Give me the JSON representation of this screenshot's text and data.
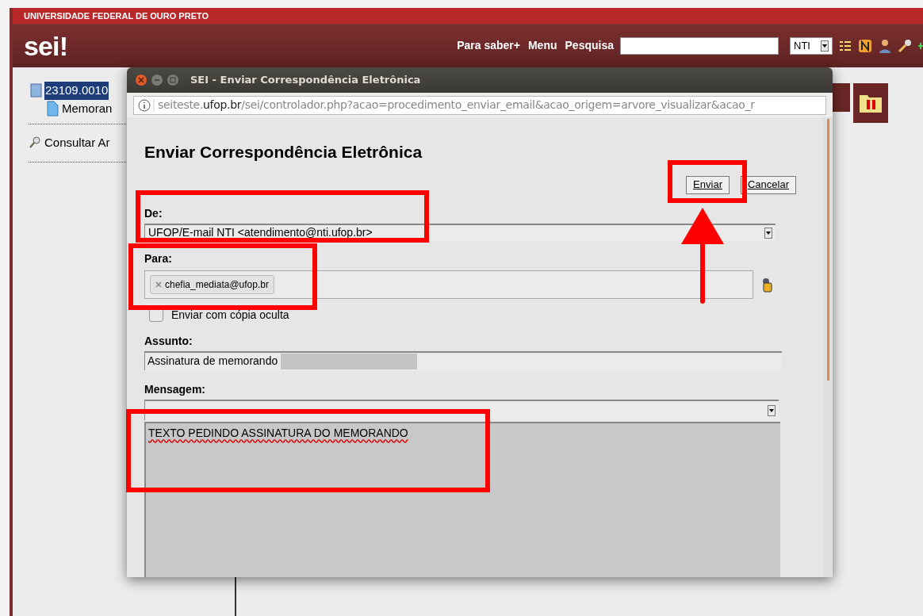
{
  "header": {
    "institution": "UNIVERSIDADE FEDERAL DE OURO PRETO",
    "logo": "sei!",
    "nav": [
      "Para saber+",
      "Menu",
      "Pesquisa"
    ],
    "unit_select": {
      "value": "NTI"
    }
  },
  "tree": [
    {
      "label": "23109.0010",
      "selected": true,
      "children": [
        {
          "label": "Memoran",
          "selected": false
        }
      ]
    }
  ],
  "side_links": [
    "Consultar Ar"
  ],
  "popup": {
    "title": "SEI - Enviar Correspondência Eletrônica",
    "url": {
      "host_start": "seiteste.",
      "host_domain": "ufop.br",
      "path": "/sei/controlador.php?acao=procedimento_enviar_email&acao_origem=arvore_visualizar&acao_r"
    },
    "heading": "Enviar Correspondência Eletrônica",
    "buttons": [
      "Enviar",
      "Cancelar"
    ],
    "from": {
      "label": "De:",
      "value": "UFOP/E-mail NTI <atendimento@nti.ufop.br>"
    },
    "to": {
      "label": "Para:",
      "recipients": [
        "chefia_mediata@ufop.br"
      ]
    },
    "bcc": {
      "label": "Enviar com cópia oculta",
      "checked": false
    },
    "subject": {
      "label": "Assunto:",
      "value": "Assinatura de memorando"
    },
    "message": {
      "label": "Mensagem:",
      "body": "TEXTO PEDINDO ASSINATURA DO MEMORANDO"
    }
  }
}
